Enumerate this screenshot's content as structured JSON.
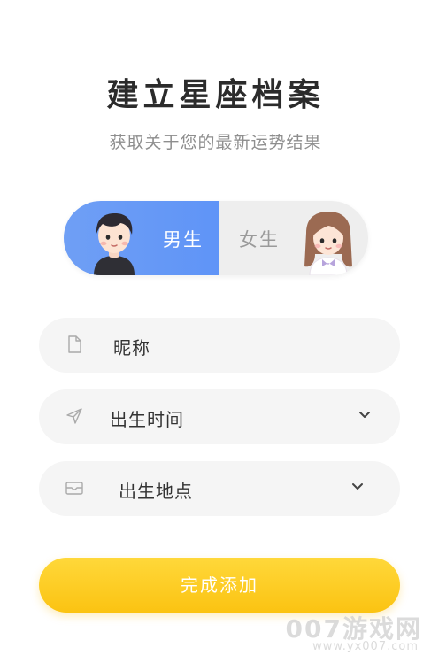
{
  "header": {
    "title": "建立星座档案",
    "subtitle": "获取关于您的最新运势结果"
  },
  "gender": {
    "male_label": "男生",
    "female_label": "女生",
    "selected": "male"
  },
  "form": {
    "nickname_label": "昵称",
    "birth_time_label": "出生时间",
    "birth_place_label": "出生地点"
  },
  "actions": {
    "submit_label": "完成添加"
  },
  "watermark": {
    "main": "007游戏网",
    "url": "www.yx007.com"
  },
  "colors": {
    "male_active": "#6f9ff5",
    "female_inactive": "#eeeeee",
    "submit": "#fbc312",
    "field_bg": "#f5f5f5"
  }
}
